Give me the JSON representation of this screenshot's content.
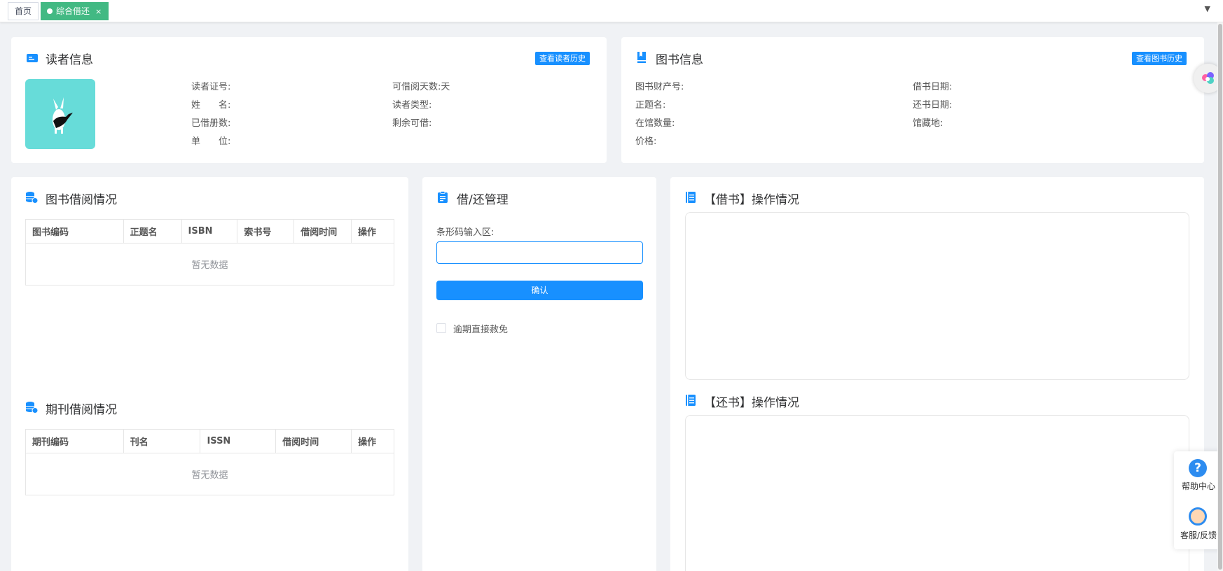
{
  "tabs": {
    "home": "首页",
    "active": "综合借还",
    "close": "×",
    "dropdown": "▼"
  },
  "reader": {
    "title": "读者信息",
    "history_button": "查看读者历史",
    "fields": {
      "card_no": "读者证号:",
      "days": "可借阅天数:天",
      "name": "姓　　名:",
      "type": "读者类型:",
      "borrowed": "已借册数:",
      "remaining": "剩余可借:",
      "unit": "单　　位:"
    }
  },
  "book": {
    "title": "图书信息",
    "history_button": "查看图书历史",
    "fields": {
      "asset_no": "图书财产号:",
      "borrow_date": "借书日期:",
      "main_title": "正题名:",
      "return_date": "还书日期:",
      "stock": "在馆数量:",
      "location": "馆藏地:",
      "price": "价格:"
    }
  },
  "book_borrow": {
    "title": "图书借阅情况",
    "columns": [
      "图书编码",
      "正题名",
      "ISBN",
      "索书号",
      "借阅时间",
      "操作"
    ],
    "empty": "暂无数据"
  },
  "journal_borrow": {
    "title": "期刊借阅情况",
    "columns": [
      "期刊编码",
      "刊名",
      "ISSN",
      "借阅时间",
      "操作"
    ],
    "empty": "暂无数据"
  },
  "manage": {
    "title": "借/还管理",
    "barcode_label": "条形码输入区:",
    "barcode_value": "",
    "confirm": "确认",
    "waive_label": "逾期直接赦免"
  },
  "borrow_ops": {
    "title": "【借书】操作情况"
  },
  "return_ops": {
    "title": "【还书】操作情况"
  },
  "float_bar": {
    "help_glyph": "?",
    "help": "帮助中心",
    "service": "客服/反馈"
  },
  "colors": {
    "primary": "#1890ff",
    "tab_active": "#42b983",
    "avatar_bg": "#67dcd9"
  }
}
